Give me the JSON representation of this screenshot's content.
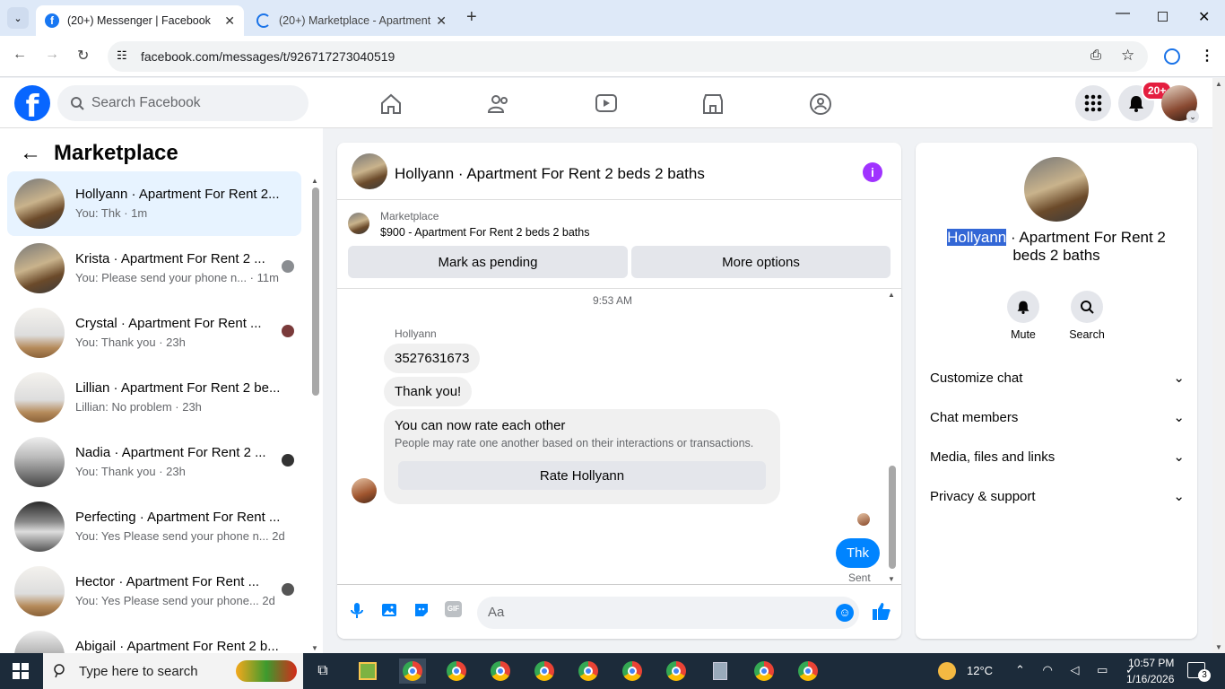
{
  "browser": {
    "tabs": [
      {
        "title": "(20+) Messenger | Facebook",
        "active": true
      },
      {
        "title": "(20+) Marketplace - Apartment",
        "active": false
      }
    ],
    "url": "facebook.com/messages/t/926717273040519"
  },
  "fb_header": {
    "search_placeholder": "Search Facebook",
    "notification_badge": "20+"
  },
  "sidebar": {
    "title": "Marketplace",
    "conversations": [
      {
        "name": "Hollyann · Apartment For Rent 2...",
        "preview": "You: Thk · 1m",
        "selected": true
      },
      {
        "name": "Krista · Apartment For Rent 2 ...",
        "preview": "You: Please send your phone n... · 11m",
        "selected": false
      },
      {
        "name": "Crystal · Apartment For Rent ...",
        "preview": "You: Thank you · 23h",
        "selected": false
      },
      {
        "name": "Lillian · Apartment For Rent 2 be...",
        "preview": "Lillian: No problem · 23h",
        "selected": false
      },
      {
        "name": "Nadia · Apartment For Rent 2 ...",
        "preview": "You: Thank you · 23h",
        "selected": false
      },
      {
        "name": "Perfecting · Apartment For Rent ...",
        "preview": "You: Yes Please send your phone n...  2d",
        "selected": false
      },
      {
        "name": "Hector · Apartment For Rent ...",
        "preview": "You: Yes Please send your phone...  2d",
        "selected": false
      },
      {
        "name": "Abigail · Apartment For Rent 2 b...",
        "preview": "",
        "selected": false
      }
    ]
  },
  "chat": {
    "title": "Hollyann · Apartment For Rent 2 beds 2 baths",
    "listing_label": "Marketplace",
    "listing_text": "$900 - Apartment For Rent 2 beds 2 baths",
    "mark_pending": "Mark as pending",
    "more_options": "More options",
    "timestamp": "9:53 AM",
    "sender": "Hollyann",
    "messages": [
      "3527631673",
      "Thank you!"
    ],
    "rate_title": "You can now rate each other",
    "rate_sub": "People may rate one another based on their interactions or transactions.",
    "rate_button": "Rate Hollyann",
    "my_message": "Thk",
    "sent_status": "Sent",
    "composer_placeholder": "Aa"
  },
  "details": {
    "name_highlight": "Hollyann",
    "title_rest": " · Apartment For Rent 2",
    "title_line2": "beds 2 baths",
    "mute": "Mute",
    "search": "Search",
    "sections": [
      "Customize chat",
      "Chat members",
      "Media, files and links",
      "Privacy & support"
    ]
  },
  "taskbar": {
    "search_placeholder": "Type here to search",
    "temperature": "12°C",
    "time": "10:57 PM",
    "date": "1/16/2026",
    "notifications": "3"
  }
}
